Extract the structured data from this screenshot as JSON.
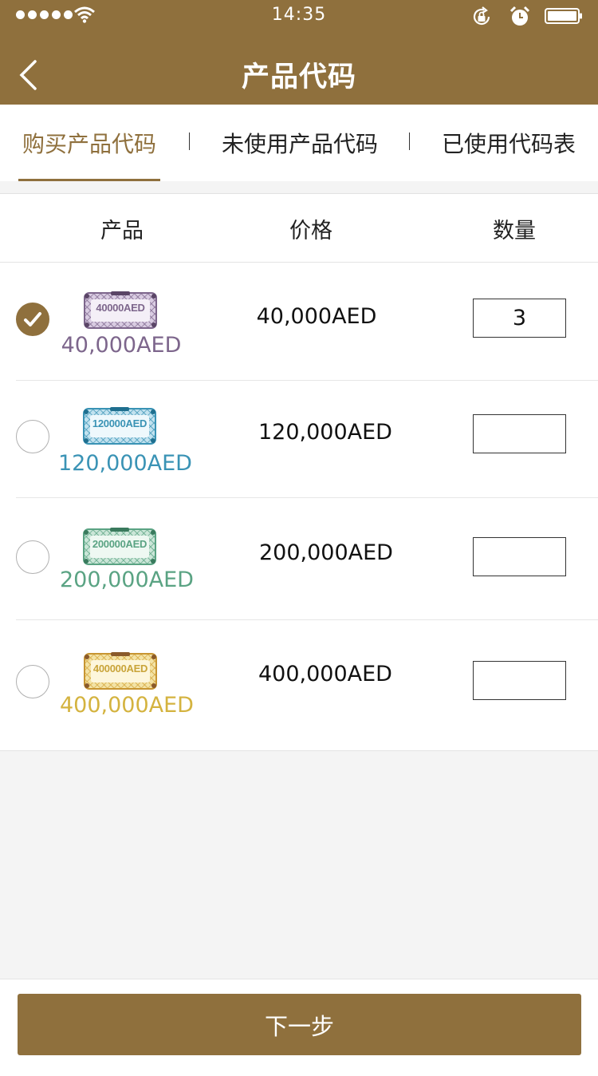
{
  "status_bar": {
    "time": "14:35",
    "icons": [
      "signal-dots-icon",
      "wifi-icon",
      "rotation-lock-icon",
      "alarm-icon",
      "battery-icon"
    ]
  },
  "header": {
    "title": "产品代码",
    "back_icon": "chevron-left-icon"
  },
  "tabs": [
    {
      "label": "购买产品代码",
      "active": true
    },
    {
      "label": "未使用产品代码",
      "active": false
    },
    {
      "label": "已使用代码表",
      "active": false
    }
  ],
  "table": {
    "headers": {
      "product": "产品",
      "price": "价格",
      "quantity": "数量"
    },
    "rows": [
      {
        "ticket_label": "40000AED",
        "amount": "40,000AED",
        "price": "40,000AED",
        "quantity": "3",
        "selected": true,
        "color": "#7d668c"
      },
      {
        "ticket_label": "120000AED",
        "amount": "120,000AED",
        "price": "120,000AED",
        "quantity": "",
        "selected": false,
        "color": "#3a93b5"
      },
      {
        "ticket_label": "200000AED",
        "amount": "200,000AED",
        "price": "200,000AED",
        "quantity": "",
        "selected": false,
        "color": "#5aa383"
      },
      {
        "ticket_label": "400000AED",
        "amount": "400,000AED",
        "price": "400,000AED",
        "quantity": "",
        "selected": false,
        "color": "#d4b33f"
      }
    ]
  },
  "footer": {
    "next_label": "下一步"
  },
  "colors": {
    "brand": "#8f703d",
    "background": "#f4f4f4"
  }
}
